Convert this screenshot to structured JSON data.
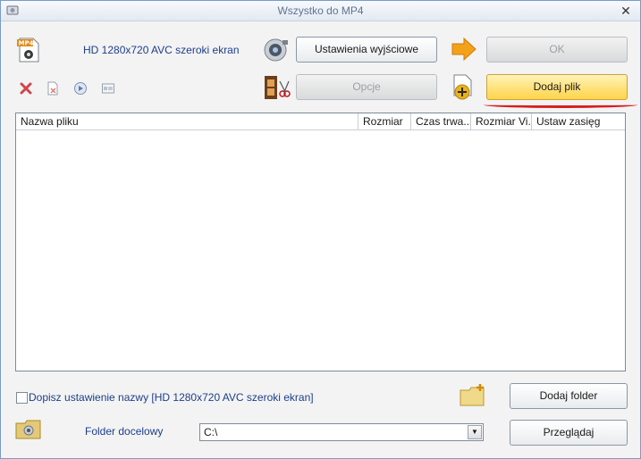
{
  "window": {
    "title": "Wszystko do MP4"
  },
  "profile": {
    "label": "HD 1280x720 AVC szeroki ekran",
    "format_icon_text": "MP4"
  },
  "buttons": {
    "output_settings": "Ustawienia wyjściowe",
    "ok": "OK",
    "options": "Opcje",
    "add_file": "Dodaj plik",
    "add_folder": "Dodaj folder",
    "browse": "Przeglądaj"
  },
  "file_list": {
    "columns": [
      "Nazwa pliku",
      "Rozmiar",
      "Czas trwa...",
      "Rozmiar Vi...",
      "Ustaw zasięg"
    ],
    "rows": []
  },
  "rename_option": {
    "label": "Dopisz ustawienie nazwy [HD 1280x720 AVC szeroki ekran]",
    "checked": false
  },
  "destination": {
    "label": "Folder docelowy",
    "value": "C:\\"
  }
}
